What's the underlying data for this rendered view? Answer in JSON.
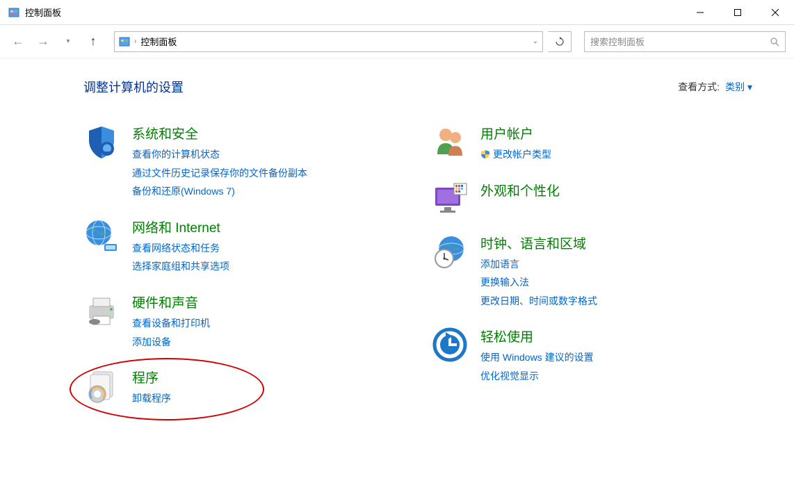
{
  "window": {
    "title": "控制面板"
  },
  "nav": {
    "breadcrumb": "控制面板",
    "search_placeholder": "搜索控制面板"
  },
  "header": {
    "title": "调整计算机的设置",
    "view_label": "查看方式:",
    "view_value": "类别"
  },
  "left": [
    {
      "title": "系统和安全",
      "links": [
        "查看你的计算机状态",
        "通过文件历史记录保存你的文件备份副本",
        "备份和还原(Windows 7)"
      ]
    },
    {
      "title": "网络和 Internet",
      "links": [
        "查看网络状态和任务",
        "选择家庭组和共享选项"
      ]
    },
    {
      "title": "硬件和声音",
      "links": [
        "查看设备和打印机",
        "添加设备"
      ]
    },
    {
      "title": "程序",
      "links": [
        "卸载程序"
      ],
      "highlighted": true
    }
  ],
  "right": [
    {
      "title": "用户帐户",
      "links": [
        "更改帐户类型"
      ],
      "shields": [
        0
      ]
    },
    {
      "title": "外观和个性化",
      "links": []
    },
    {
      "title": "时钟、语言和区域",
      "links": [
        "添加语言",
        "更换输入法",
        "更改日期、时间或数字格式"
      ]
    },
    {
      "title": "轻松使用",
      "links": [
        "使用 Windows 建议的设置",
        "优化视觉显示"
      ]
    }
  ]
}
